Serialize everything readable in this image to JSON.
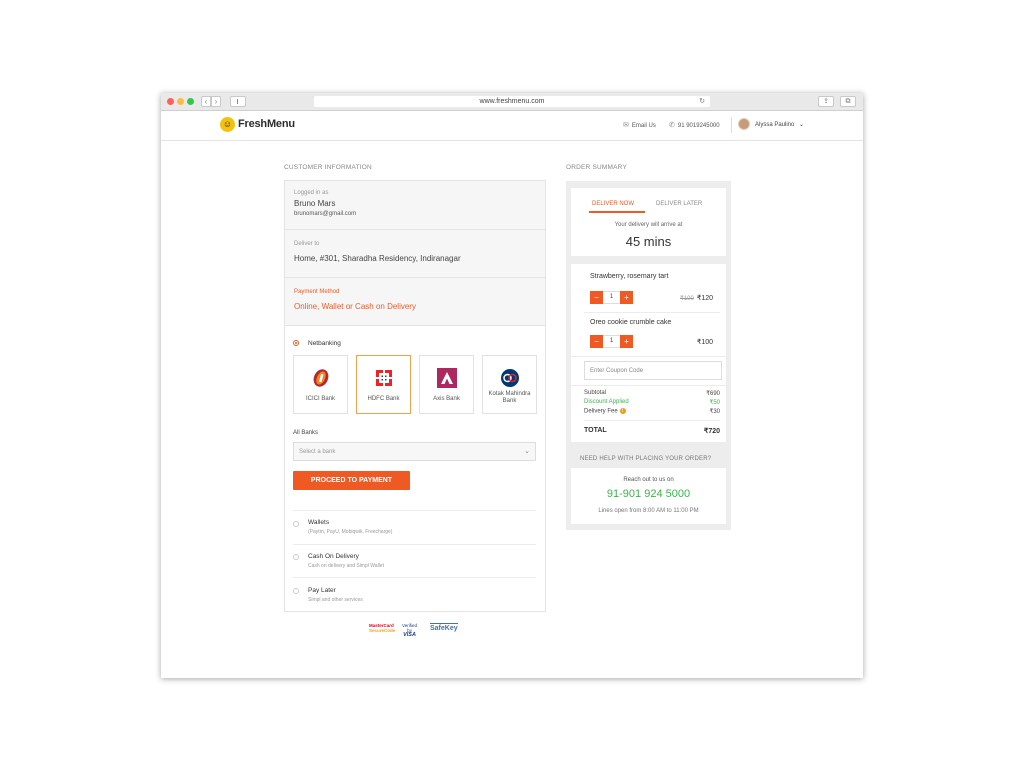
{
  "browser": {
    "url": "www.freshmenu.com",
    "back_icon": "‹",
    "forward_icon": "›",
    "reload_icon": "↻",
    "share_icon": "⇪",
    "tabs_icon": "⧉"
  },
  "header": {
    "brand": "FreshMenu",
    "email_label": "Email Us",
    "phone": "91 9019245000",
    "user_name": "Alyssa Paulino",
    "user_chevron": "⌄"
  },
  "customer_info": {
    "section_title": "CUSTOMER INFORMATION",
    "logged_in_label": "Logged in as",
    "user_name": "Bruno Mars",
    "user_email": "brunomars@gmail.com",
    "deliver_to_label": "Deliver to",
    "address": "Home, #301, Sharadha Residency, Indiranagar",
    "payment_method_label": "Payment Method",
    "payment_method": "Online, Wallet or Cash on Delivery"
  },
  "payment": {
    "netbanking_label": "Netbanking",
    "banks": [
      {
        "name": "ICICI Bank"
      },
      {
        "name": "HDFC Bank"
      },
      {
        "name": "Axis Bank"
      },
      {
        "name": "Kotak Mahindra Bank"
      }
    ],
    "selected_bank_index": 1,
    "all_banks_label": "All Banks",
    "select_placeholder": "Select a bank",
    "select_chevron": "⌄",
    "proceed_label": "PROCEED TO PAYMENT",
    "options": [
      {
        "label": "Wallets",
        "sub": "(Paytm, PayU, Mobiqwik, Freecharge)"
      },
      {
        "label": "Cash On Delivery",
        "sub": "Cash on delivery and Simpl Wallet"
      },
      {
        "label": "Pay Later",
        "sub": "Simpl and other services"
      }
    ],
    "badges": {
      "mastercard_1": "MasterCard",
      "mastercard_2": "SecureCode",
      "verified_by": "Verified by",
      "visa": "VISA",
      "safekey": "SafeKey"
    }
  },
  "order_summary": {
    "section_title": "ORDER SUMMARY",
    "tab_now": "DELIVER NOW",
    "tab_later": "DELIVER LATER",
    "arrive_label": "Your delivery will arrive at",
    "arrive_time": "45 mins",
    "items": [
      {
        "name": "Strawberry, rosemary tart",
        "qty": "1",
        "old_price": "₹100",
        "price": "₹120"
      },
      {
        "name": "Oreo cookie crumble cake",
        "qty": "1",
        "price": "₹100"
      }
    ],
    "minus": "−",
    "plus": "+",
    "coupon_placeholder": "Enter Coupon Code",
    "subtotal_label": "Subtotal",
    "subtotal": "₹690",
    "discount_label": "Discount Applied",
    "discount": "₹50",
    "delivery_label": "Delivery Fee",
    "delivery_info": "i",
    "delivery": "₹30",
    "total_label": "TOTAL",
    "total": "₹720",
    "help_title": "NEED HELP WITH PLACING YOUR ORDER?",
    "reach_label": "Reach out to us on",
    "help_phone": "91-901 924 5000",
    "help_hours": "Lines open from 8:00 AM to 11:00 PM"
  },
  "colors": {
    "accent": "#ef5a24",
    "success": "#39b54a",
    "brand_yellow": "#f4c20d"
  }
}
